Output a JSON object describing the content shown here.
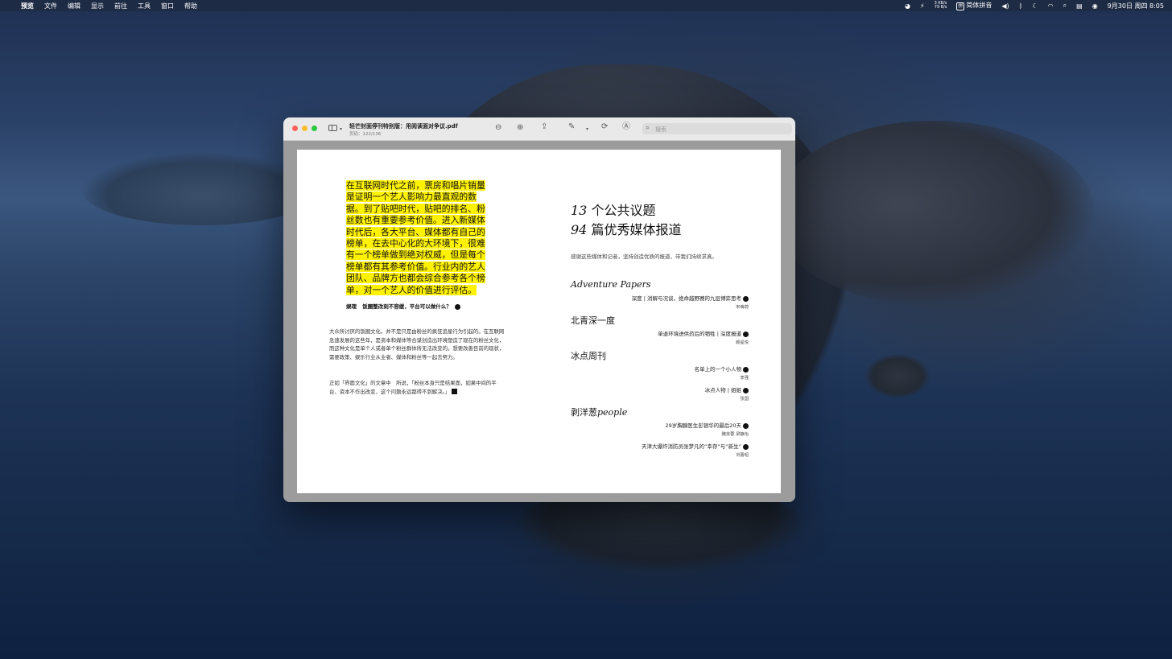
{
  "menubar": {
    "app": "预览",
    "menus": [
      "文件",
      "编辑",
      "显示",
      "前往",
      "工具",
      "窗口",
      "帮助"
    ],
    "net_up": "3 KB/s",
    "net_down": "79 B/s",
    "input_method": "简体拼音",
    "datetime": "9月30日 周四  8:05"
  },
  "window": {
    "title": "轻芒封面停刊特别版：用阅读面对争议.pdf",
    "subtitle": "页码：122/136",
    "search_placeholder": "搜索"
  },
  "left_page": {
    "quote": "在互联网时代之前，票房和唱片销量是证明一个艺人影响力最直观的数据。到了贴吧时代，贴吧的排名、粉丝数也有重要参考价值。进入新媒体时代后，各大平台、媒体都有自己的榜单，在去中心化的大环境下，很难有一个榜单做到绝对权威，但是每个榜单都有其参考价值。行业内的艺人团队、品牌方也都会综合参考各个榜单，对一个艺人的价值进行评估。",
    "caption_source": "娱理",
    "caption_title": "饭圈整改刻不容缓，平台可以做什么？",
    "paragraph1": "大众所讨厌的饭圈文化，并不是只是由粉丝的疯狂追星行为引起的。在互联网急速发展的这些年，是资本和媒体等合谋创造出环境塑造了现在的粉丝文化，而这种文化是单个人或者单个粉丝群体所无法改变的。想要改善目前的现状，需要政策、娱乐行业从业者、媒体和粉丝等一起去努力。",
    "paragraph2": "正如「界面文化」的文章中　所说，「粉丝本身只是结果面，如果中间的平台、资本不作出改变，这个问题永远都得不到解决。」"
  },
  "right_page": {
    "line1_num": "13",
    "line1_text": " 个公共议题",
    "line2_num": "94",
    "line2_text": " 篇优秀媒体报道",
    "thanks": "感谢这些媒体和记者，坚持创造优质的报道，带我们持续求真。",
    "sections": [
      {
        "publication": "Adventure Papers",
        "articles": [
          {
            "title": "深度 | 消解与况谈，绝命越野赛的九层博弈思考",
            "author": "宋萌蔚"
          }
        ]
      },
      {
        "publication": "北青深一度",
        "articles": [
          {
            "title": "单退环境进供药后的牺牲 | 深度报道",
            "author": "颜星悦"
          }
        ]
      },
      {
        "publication": "冰点周刊",
        "articles": [
          {
            "title": "名单上的一个小人物",
            "author": "李强"
          },
          {
            "title": "冰点人物 | 姐姐",
            "author": "张国"
          }
        ]
      },
      {
        "publication_cn": "剥洋葱",
        "publication_en": "people",
        "articles": [
          {
            "title": "29岁胸腺医生彭银华的最后20天",
            "author": "魏芙蓉 梁静怡"
          },
          {
            "title": "天津大爆炸消防员张梦凡的“幸存”与“新生”",
            "author": "刘蕾昭"
          }
        ]
      }
    ]
  }
}
